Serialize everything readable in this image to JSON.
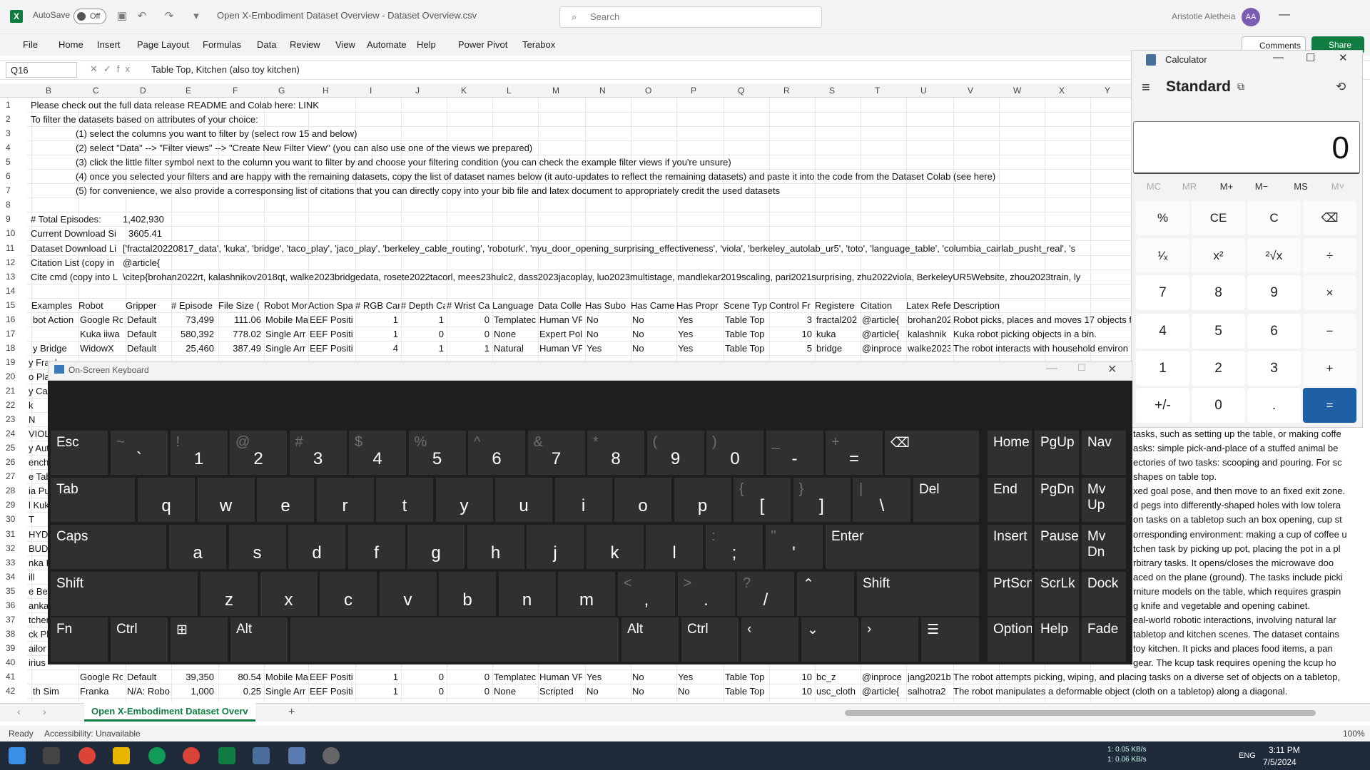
{
  "titlebar": {
    "app_icon": "X",
    "autosave": "AutoSave",
    "autosave_state": "Off",
    "doc_title": "Open X-Embodiment Dataset Overview - Dataset Overview.csv",
    "search_placeholder": "Search",
    "user": "Aristotle Aletheia",
    "initials": "AA"
  },
  "menu": [
    "File",
    "Home",
    "Insert",
    "Page Layout",
    "Formulas",
    "Data",
    "Review",
    "View",
    "Automate",
    "Help",
    "Power Pivot",
    "Terabox"
  ],
  "actions": {
    "comments": "Comments",
    "share": "Share"
  },
  "formula": {
    "namebox": "Q16",
    "fx": "fx",
    "value": "Table Top, Kitchen (also toy kitchen)"
  },
  "columns": [
    "B",
    "C",
    "D",
    "E",
    "F",
    "G",
    "H",
    "I",
    "J",
    "K",
    "L",
    "M",
    "N",
    "O",
    "P",
    "Q",
    "R",
    "S",
    "T",
    "U",
    "V",
    "W",
    "X",
    "Y"
  ],
  "rows": [
    "1",
    "2",
    "3",
    "4",
    "5",
    "6",
    "7",
    "8",
    "9",
    "10",
    "11",
    "12",
    "13",
    "14",
    "15",
    "16",
    "17",
    "18",
    "19",
    "20",
    "21",
    "22",
    "23",
    "24",
    "25",
    "26",
    "27",
    "28",
    "29",
    "30",
    "31",
    "32",
    "33",
    "34",
    "35",
    "36",
    "37",
    "38",
    "39",
    "40",
    "41",
    "42"
  ],
  "sheet_text": {
    "r1": "Please check out the full data release README and Colab here: LINK",
    "r2": "To filter the datasets based on attributes of your choice:",
    "r3": "(1) select the columns you want to filter by (select row 15 and below)",
    "r4": "(2) select \"Data\" --> \"Filter views\" --> \"Create New Filter View\" (you can also use one of the views we prepared)",
    "r5": "(3) click the little filter symbol next to the column you want to filter by and choose your filtering condition (you can check the example filter views if you're unsure)",
    "r6": "(4) once you selected your filters and are happy with the remaining datasets, copy the list of dataset names below (it auto-updates to reflect the remaining datasets) and paste it into the code from the Dataset Colab (see here)",
    "r7": "(5) for convenience, we also provide a corresponsing list of citations that you can directly copy into your bib file and latex document to appropriately credit the used datasets",
    "r9a": "# Total Episodes:",
    "r9b": "1,402,930",
    "r10a": "Current Download Si",
    "r10b": "3605.41",
    "r11a": "Dataset Download Li",
    "r11b": "['fractal20220817_data', 'kuka', 'bridge', 'taco_play', 'jaco_play', 'berkeley_cable_routing', 'roboturk', 'nyu_door_opening_surprising_effectiveness', 'viola', 'berkeley_autolab_ur5', 'toto', 'language_table', 'columbia_cairlab_pusht_real', 's",
    "r12a": "Citation List (copy in",
    "r12b": "@article{",
    "r13a": "Cite cmd (copy into L",
    "r13b": "\\citep{brohan2022rt, kalashnikov2018qt, walke2023bridgedata, rosete2022tacorl, mees23hulc2, dass2023jacoplay, luo2023multistage, mandlekar2019scaling, pari2021surprising, zhu2022viola, BerkeleyUR5Website, zhou2023train, ly"
  },
  "header_row": [
    "Examples",
    "Robot",
    "Gripper",
    "# Episode",
    "File Size (",
    "Robot Mor",
    "Action Spa",
    "# RGB Can",
    "# Depth Ca",
    "# Wrist Ca",
    "Language",
    "Data Colle",
    "Has Subo",
    "Has Came",
    "Has Propr",
    "Scene Typ",
    "Control Fr",
    "Registere",
    "Citation",
    "Latex Refe",
    "Description"
  ],
  "data_rows": [
    [
      "bot Action",
      "Google Ro",
      "Default",
      "73,499",
      "111.06",
      "Mobile Ma",
      "EEF Positi",
      "1",
      "1",
      "0",
      "Templatec",
      "Human VR",
      "No",
      "No",
      "Yes",
      "Table Top",
      "3",
      "fractal202",
      "@article{",
      "brohan202",
      "Robot picks, places and moves 17 objects fr"
    ],
    [
      "",
      "Kuka iiwa",
      "Default",
      "580,392",
      "778.02",
      "Single Arr",
      "EEF Positi",
      "1",
      "0",
      "0",
      "None",
      "Expert Pol",
      "No",
      "No",
      "Yes",
      "Table Top",
      "10",
      "kuka",
      "@article{",
      "kalashnik",
      "Kuka robot picking objects in a bin."
    ],
    [
      "y Bridge",
      "WidowX",
      "Default",
      "25,460",
      "387.49",
      "Single Arr",
      "EEF Positi",
      "4",
      "1",
      "1",
      "Natural",
      "Human VR",
      "Yes",
      "No",
      "Yes",
      "Table Top",
      "5",
      "bridge",
      "@inproce",
      "walke2023",
      "The robot interacts with household environ"
    ]
  ],
  "left_fragments": [
    "y Frank",
    "o Play",
    "y Cable",
    "k",
    "N",
    "VIOLA",
    "y Autol",
    "enchm",
    "e Tabl",
    "ia Pus",
    "l Kuka",
    "T",
    "HYDR",
    "BUDS",
    "nka Pl",
    "ill",
    "e Benc",
    "anka Ex",
    "tchen",
    "ck Plac",
    "ailor",
    "irius"
  ],
  "right_fragments": [
    "tasks, such as setting up the table, or making coffe",
    "asks: simple pick-and-place of a stuffed animal be",
    "ectories of two tasks: scooping and pouring. For sc",
    "shapes on table top.",
    "xed goal pose, and then move to an fixed exit zone.",
    "d pegs into differently-shaped holes with low tolera",
    "on tasks on a tabletop such an box opening, cup st",
    "orresponding environment: making a cup of coffee u",
    "tchen task by picking up pot, placing the pot in a pl",
    "rbitrary tasks. It opens/closes the microwave doo",
    "aced on the plane (ground). The tasks include picki",
    "rniture models on the table, which requires graspin",
    "g knife and vegetable and opening cabinet.",
    "eal-world robotic interactions, involving natural lar",
    "tabletop and kitchen scenes. The dataset contains",
    "toy kitchen. It picks and places food items, a pan",
    "gear. The kcup task requires opening the kcup ho"
  ],
  "bottom_rows": [
    [
      "",
      "Google Ro",
      "Default",
      "39,350",
      "80.54",
      "Mobile Ma",
      "EEF Positi",
      "1",
      "0",
      "0",
      "Templatec",
      "Human VR",
      "Yes",
      "No",
      "Yes",
      "Table Top",
      "10",
      "bc_z",
      "@inproce",
      "jang2021b",
      "The robot attempts picking, wiping, and placing tasks on a diverse set of objects on a tabletop,"
    ],
    [
      "th Sim",
      "Franka",
      "N/A: Robo",
      "1,000",
      "0.25",
      "Single Arr",
      "EEF Positi",
      "1",
      "0",
      "0",
      "None",
      "Scripted",
      "No",
      "No",
      "No",
      "Table Top",
      "10",
      "usc_cloth",
      "@article{",
      "salhotra2",
      "The robot manipulates a deformable object (cloth on a tabletop) along a diagonal."
    ]
  ],
  "sheet_tab": "Open X-Embodiment Dataset Overv",
  "status": {
    "ready": "Ready",
    "accessibility": "Accessibility: Unavailable",
    "zoom": "100%"
  },
  "taskbar": {
    "time": "3:11 PM",
    "date": "7/5/2024",
    "lang": "ENG",
    "up": "1: 0.05 KB/s",
    "down": "1: 0.06 KB/s"
  },
  "calculator": {
    "title": "Calculator",
    "mode": "Standard",
    "display": "0",
    "memory": [
      "MC",
      "MR",
      "M+",
      "M−",
      "MS",
      "M˅"
    ],
    "keys": [
      "%",
      "CE",
      "C",
      "⌫",
      "¹⁄ₓ",
      "x²",
      "²√x",
      "÷",
      "7",
      "8",
      "9",
      "×",
      "4",
      "5",
      "6",
      "−",
      "1",
      "2",
      "3",
      "+",
      "+/-",
      "0",
      ".",
      "="
    ]
  },
  "osk": {
    "title": "On-Screen Keyboard",
    "row1": [
      [
        "~",
        "`"
      ],
      [
        "!",
        "1"
      ],
      [
        "@",
        "2"
      ],
      [
        "#",
        "3"
      ],
      [
        "$",
        "4"
      ],
      [
        "%",
        "5"
      ],
      [
        "^",
        "6"
      ],
      [
        "&",
        "7"
      ],
      [
        "*",
        "8"
      ],
      [
        "(",
        "9"
      ],
      [
        ")",
        "0"
      ],
      [
        "_",
        "-"
      ],
      [
        "+",
        "="
      ]
    ],
    "esc": "Esc",
    "tab": "Tab",
    "caps": "Caps",
    "shift": "Shift",
    "fn": "Fn",
    "ctrl": "Ctrl",
    "alt": "Alt",
    "del": "Del",
    "enter": "Enter",
    "row2": [
      "q",
      "w",
      "e",
      "r",
      "t",
      "y",
      "u",
      "i",
      "o",
      "p"
    ],
    "row2b": [
      [
        "{",
        "["
      ],
      [
        "}",
        "]"
      ],
      [
        "|",
        "\\"
      ]
    ],
    "row3": [
      "a",
      "s",
      "d",
      "f",
      "g",
      "h",
      "j",
      "k",
      "l"
    ],
    "row3b": [
      [
        ":",
        ";"
      ],
      [
        "\"",
        "'"
      ]
    ],
    "row4": [
      "z",
      "x",
      "c",
      "v",
      "b",
      "n",
      "m"
    ],
    "row4b": [
      [
        "<",
        ","
      ],
      [
        ">",
        "."
      ],
      [
        "?",
        "/"
      ]
    ],
    "nav": [
      "Home",
      "PgUp",
      "Nav",
      "End",
      "PgDn",
      "Mv Up",
      "Insert",
      "Pause",
      "Mv Dn",
      "PrtScn",
      "ScrLk",
      "Dock",
      "Options",
      "Help",
      "Fade"
    ]
  }
}
